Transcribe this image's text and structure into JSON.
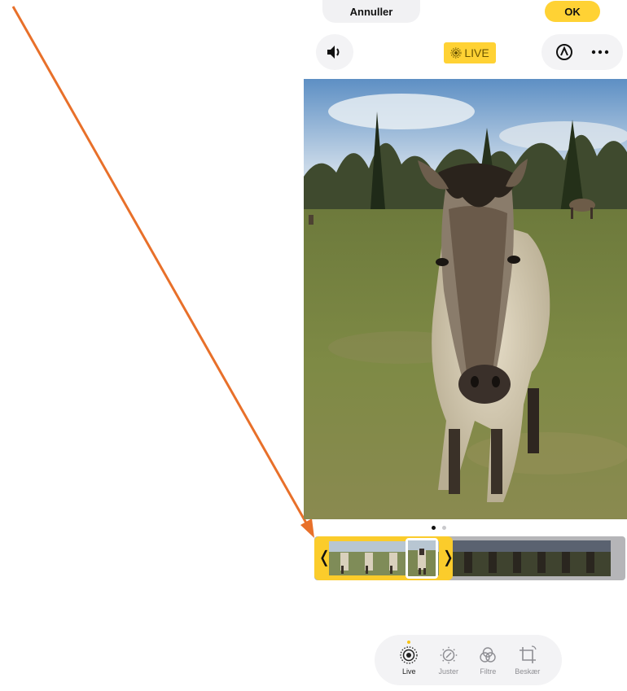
{
  "header": {
    "cancel_label": "Annuller",
    "ok_label": "OK"
  },
  "controls": {
    "live_label": "LIVE",
    "sound_icon": "speaker-icon",
    "markup_icon": "markup-icon",
    "more_icon": "more-icon"
  },
  "colors": {
    "accent": "#ffd234",
    "arrow": "#e8702a"
  },
  "pagination": {
    "pages": 2,
    "active_page": 1
  },
  "toolbar": {
    "tools": [
      {
        "label": "Live",
        "icon": "live-icon",
        "active": true
      },
      {
        "label": "Juster",
        "icon": "adjust-icon",
        "active": false
      },
      {
        "label": "Filtre",
        "icon": "filters-icon",
        "active": false
      },
      {
        "label": "Beskær",
        "icon": "crop-icon",
        "active": false
      }
    ]
  }
}
